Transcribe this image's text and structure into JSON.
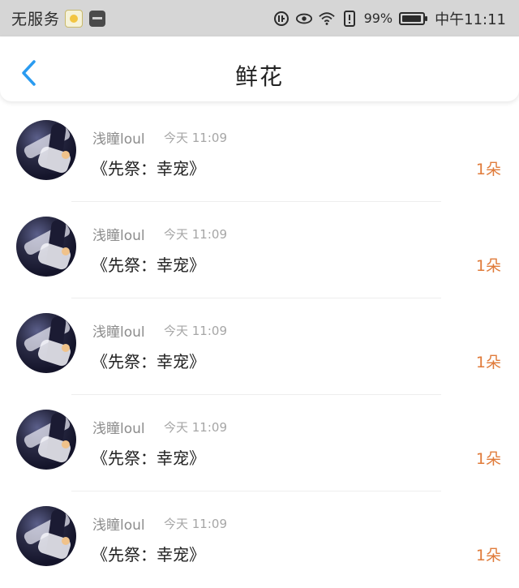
{
  "status_bar": {
    "carrier": "无服务",
    "battery_percent": "99%",
    "time": "中午11:11",
    "icons": [
      "notification-app-icon",
      "hms-app-icon",
      "data-saver-icon",
      "eye-icon",
      "wifi-icon",
      "alert-icon",
      "battery-icon"
    ]
  },
  "nav": {
    "back_icon": "chevron-left-icon",
    "title": "鲜花"
  },
  "colors": {
    "accent": "#2a9bf0",
    "count": "#e07b3a",
    "name": "#8c8c8c",
    "time": "#a6a6a6"
  },
  "items": [
    {
      "name": "浅瞳loul",
      "time": "今天 11:09",
      "gift": "《先祭：幸宠》",
      "count": "1朵"
    },
    {
      "name": "浅瞳loul",
      "time": "今天 11:09",
      "gift": "《先祭：幸宠》",
      "count": "1朵"
    },
    {
      "name": "浅瞳loul",
      "time": "今天 11:09",
      "gift": "《先祭：幸宠》",
      "count": "1朵"
    },
    {
      "name": "浅瞳loul",
      "time": "今天 11:09",
      "gift": "《先祭：幸宠》",
      "count": "1朵"
    },
    {
      "name": "浅瞳loul",
      "time": "今天 11:09",
      "gift": "《先祭：幸宠》",
      "count": "1朵"
    }
  ]
}
